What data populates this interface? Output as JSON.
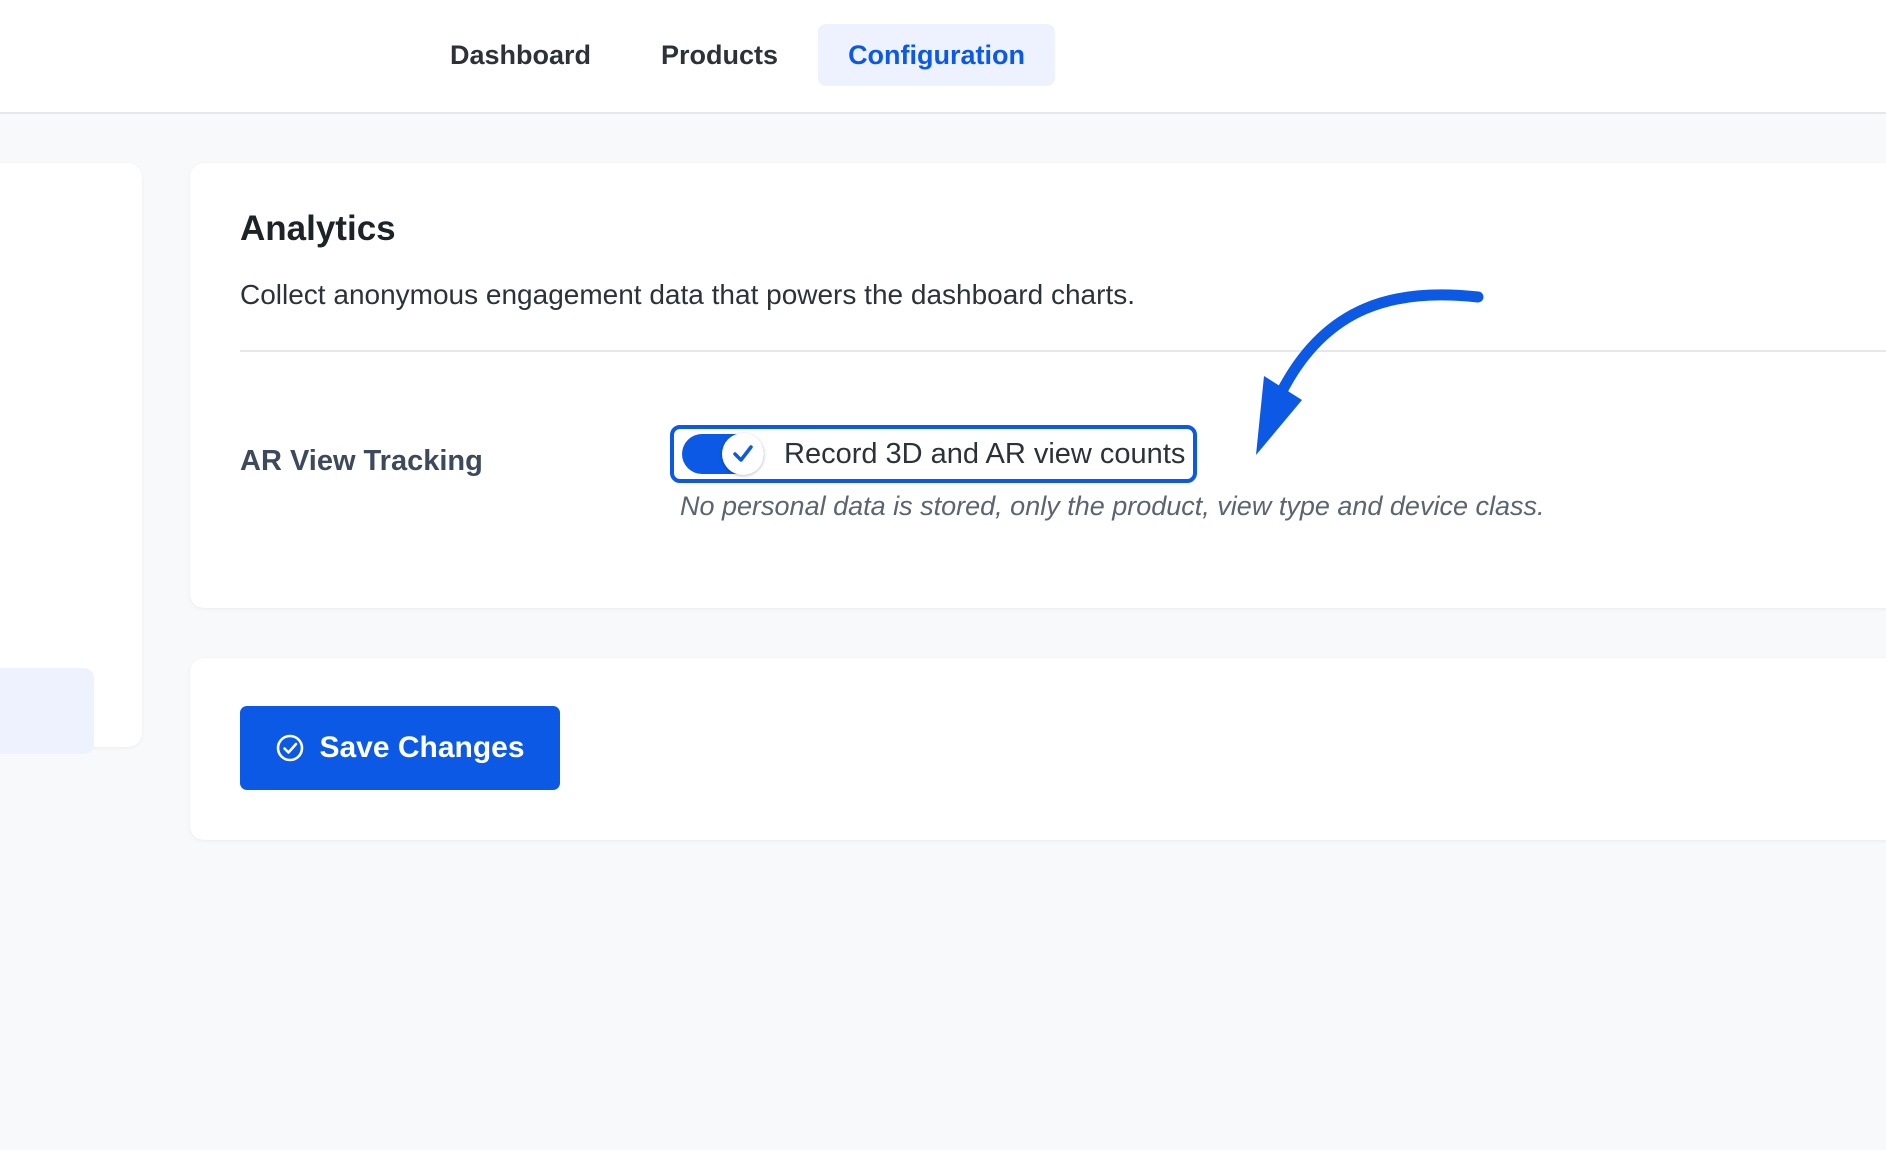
{
  "nav": {
    "tabs": [
      {
        "label": "Dashboard",
        "active": false
      },
      {
        "label": "Products",
        "active": false
      },
      {
        "label": "Configuration",
        "active": true
      }
    ]
  },
  "analytics": {
    "title": "Analytics",
    "description": "Collect anonymous engagement data that powers the dashboard charts.",
    "setting_label": "AR View Tracking",
    "toggle_label": "Record 3D and AR view counts",
    "toggle_on": true,
    "help_text": "No personal data is stored, only the product, view type and device class."
  },
  "footer": {
    "save_label": "Save Changes"
  },
  "icons": {
    "toggle_knob": "check-icon",
    "save": "check-circle-icon",
    "annotation": "arrow-icon"
  },
  "colors": {
    "accent": "#0b59e5",
    "active_tab_bg": "#edf2fe",
    "background": "#f8f9fb"
  }
}
